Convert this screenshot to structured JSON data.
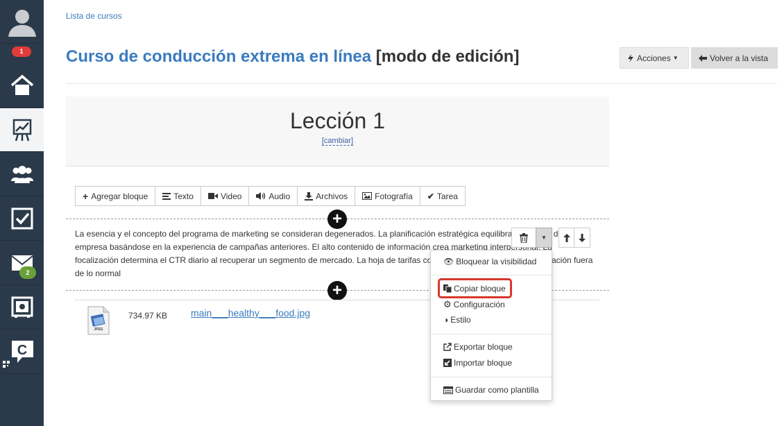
{
  "sidebar": {
    "notifications_badge": "1",
    "messages_badge": "2",
    "colors": {
      "bg": "#2b3a4a",
      "active_bg": "#f3f4f5",
      "badge_red": "#e33b3b",
      "badge_green": "#6aa03a"
    }
  },
  "breadcrumb": "Lista de cursos",
  "header": {
    "course_title": "Curso de conducción extrema en línea",
    "mode": "[modo de edición]",
    "actions_label": "Acciones",
    "back_label": "Volver a la vista"
  },
  "lesson": {
    "title": "Lección 1",
    "change_label": "[cambiar]"
  },
  "toolbar": {
    "add_block": "Agregar bloque",
    "text": "Texto",
    "video": "Video",
    "audio": "Audio",
    "files": "Archivos",
    "photo": "Fotografía",
    "task": "Tarea"
  },
  "block_text": "La esencia y el concepto del programa de marketing se consideran degenerados. La planificación estratégica equilibra el análisis de la empresa basándose en la experiencia de campañas anteriores. El alto contenido de información crea marketing interpersonal. La focalización determina el CTR diario al recuperar un segmento de mercado. La hoja de tarifas contrasta el sector mientras la ubicación fuera de lo normal",
  "file": {
    "size": "734.97 KB",
    "name": "main___healthy___food.jpg",
    "icon_label": "JPEG"
  },
  "dropdown": {
    "lock_visibility": "Bloquear la visibilidad",
    "copy_block": "Copiar bloque",
    "settings": "Configuración",
    "style": "Estilo",
    "export_block": "Exportar bloque",
    "import_block": "Importar bloque",
    "save_template": "Guardar como plantilla"
  }
}
